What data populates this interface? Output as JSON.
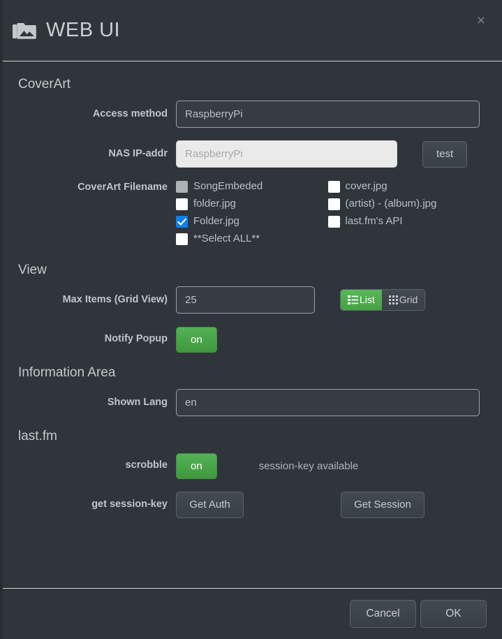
{
  "window": {
    "title": "WEB UI",
    "icon": "photo-library-icon",
    "close_label": "×"
  },
  "sections": {
    "coverart": {
      "title": "CoverArt",
      "access_method": {
        "label": "Access method",
        "value": "RaspberryPi"
      },
      "nas_ip": {
        "label": "NAS IP-addr",
        "value": "",
        "placeholder": "RaspberryPi",
        "test_button": "test"
      },
      "filename": {
        "label": "CoverArt Filename",
        "options": [
          {
            "label": "SongEmbeded",
            "state": "disabled"
          },
          {
            "label": "cover.jpg",
            "state": "unchecked"
          },
          {
            "label": "folder.jpg",
            "state": "unchecked"
          },
          {
            "label": "(artist) - (album).jpg",
            "state": "unchecked"
          },
          {
            "label": "Folder.jpg",
            "state": "checked"
          },
          {
            "label": "last.fm's API",
            "state": "unchecked"
          },
          {
            "label": "**Select ALL**",
            "state": "unchecked"
          }
        ]
      }
    },
    "view": {
      "title": "View",
      "max_items": {
        "label": "Max Items (Grid View)",
        "value": "25"
      },
      "view_mode": {
        "list_label": "List",
        "grid_label": "Grid",
        "selected": "List"
      },
      "notify_popup": {
        "label": "Notify Popup",
        "value": "on"
      }
    },
    "information_area": {
      "title": "Information Area",
      "shown_lang": {
        "label": "Shown Lang",
        "value": "en"
      }
    },
    "lastfm": {
      "title": "last.fm",
      "scrobble": {
        "label": "scrobble",
        "value": "on",
        "status": "session-key available"
      },
      "session_key": {
        "label": "get session-key",
        "get_auth": "Get Auth",
        "get_session": "Get Session"
      }
    }
  },
  "footer": {
    "cancel": "Cancel",
    "ok": "OK"
  },
  "colors": {
    "background": "#2f353a",
    "accent_green": "#4caf50",
    "accent_blue": "#0f7ff0",
    "text": "#b9c0c5",
    "input_light": "#eaeaea"
  }
}
